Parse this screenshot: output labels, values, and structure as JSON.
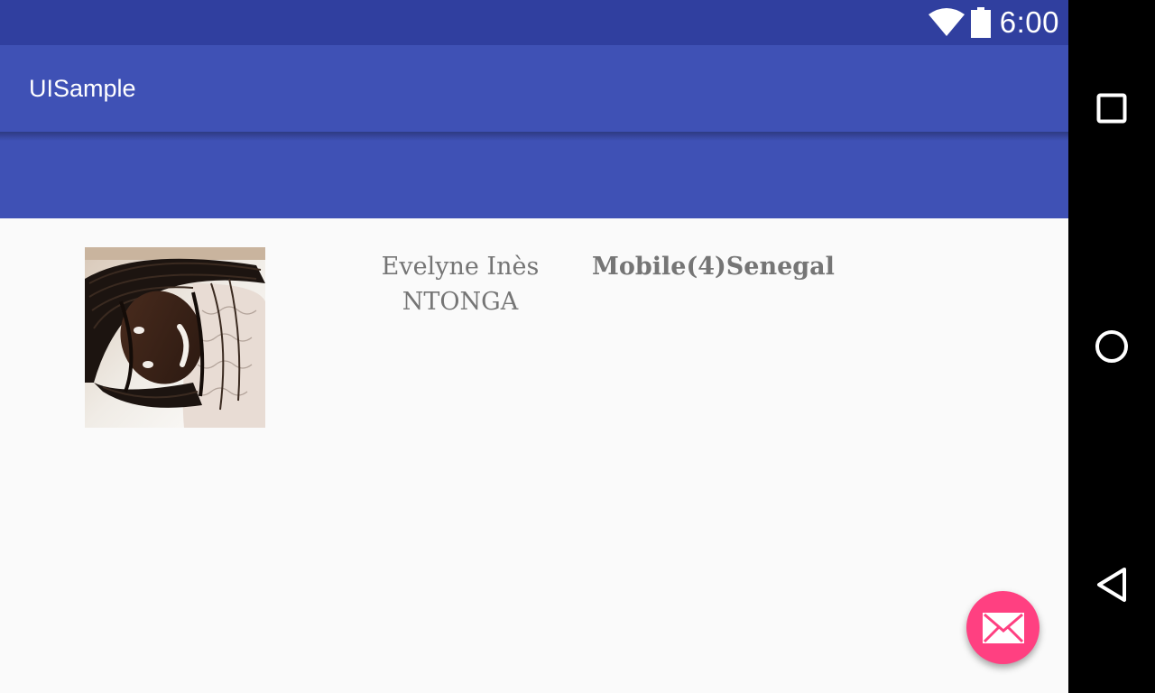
{
  "status_bar": {
    "time": "6:00",
    "wifi_icon": "wifi-icon",
    "battery_icon": "battery-icon"
  },
  "app_bar": {
    "title": "UISample"
  },
  "profile": {
    "photo_icon": "profile-photo",
    "name": "Evelyne Inès NTONGA",
    "country": "Mobile(4)Senegal"
  },
  "fab": {
    "icon": "email-icon"
  },
  "nav_bar": {
    "recents_icon": "square-icon",
    "home_icon": "circle-icon",
    "back_icon": "triangle-back-icon"
  },
  "colors": {
    "status_bar": "#303f9f",
    "primary": "#3f51b5",
    "accent": "#ff4081",
    "background": "#fafafa",
    "text_secondary": "#757575"
  }
}
